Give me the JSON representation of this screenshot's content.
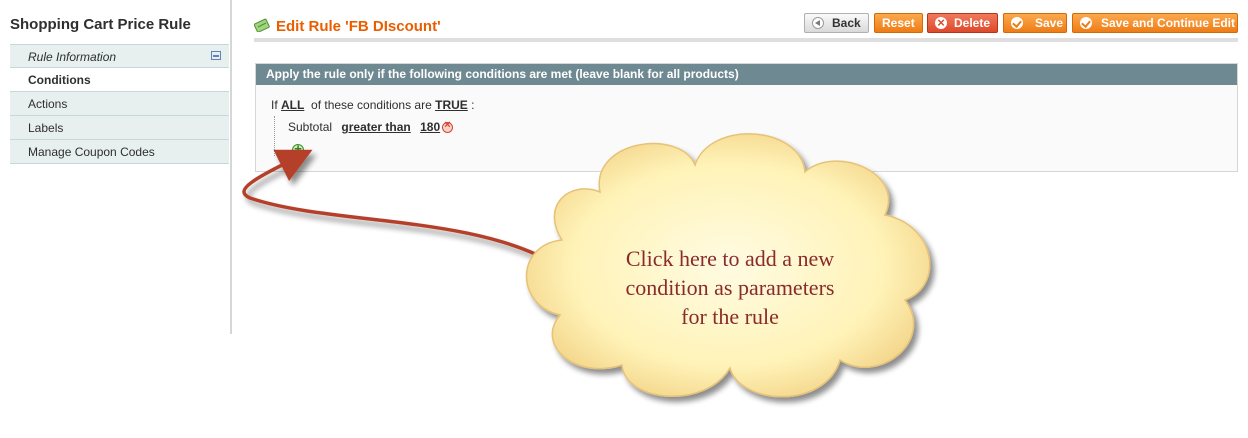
{
  "sidebar": {
    "title": "Shopping Cart Price Rule",
    "items": [
      {
        "label": "Rule Information"
      },
      {
        "label": "Conditions"
      },
      {
        "label": "Actions"
      },
      {
        "label": "Labels"
      },
      {
        "label": "Manage Coupon Codes"
      }
    ]
  },
  "header": {
    "title": "Edit Rule 'FB DIscount'",
    "buttons": {
      "back": "Back",
      "reset": "Reset",
      "delete": "Delete",
      "save": "Save",
      "save_continue": "Save and Continue Edit"
    }
  },
  "conditions": {
    "heading": "Apply the rule only if the following conditions are met (leave blank for all products)",
    "prefix": "If",
    "aggregator": "ALL",
    "middle": "of these conditions are",
    "value": "TRUE",
    "suffix": ":",
    "rule": {
      "attribute": "Subtotal",
      "operator": "greater than",
      "value": "180"
    }
  },
  "callout": {
    "lines": [
      "Click here to add a new",
      "condition as parameters",
      "for the rule"
    ]
  },
  "colors": {
    "accent_orange": "#eb5e00",
    "box_header": "#6f8992",
    "callout_fill": "#fff6c0",
    "callout_text": "#8a2b2b",
    "arrow": "#b5402a"
  },
  "icons": [
    "edit-icon",
    "collapse-icon",
    "back-arrow-icon",
    "delete-icon",
    "check-icon",
    "remove-icon",
    "add-icon"
  ]
}
